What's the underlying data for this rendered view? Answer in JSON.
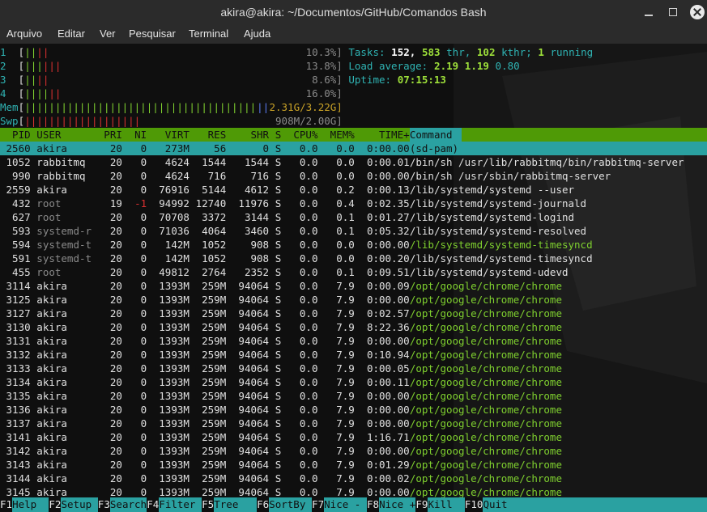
{
  "window": {
    "title": "akira@akira: ~/Documentos/GitHub/Comandos Bash"
  },
  "menu": [
    "Arquivo",
    "Editar",
    "Ver",
    "Pesquisar",
    "Terminal",
    "Ajuda"
  ],
  "meters": {
    "cpus": [
      {
        "id": "1",
        "bar_green": "||",
        "bar_red": "||",
        "pct": "10.3%]"
      },
      {
        "id": "2",
        "bar_green": "|||",
        "bar_red": "|||",
        "pct": "13.8%]"
      },
      {
        "id": "3",
        "bar_green": "||",
        "bar_red": "||",
        "pct": "8.6%]"
      },
      {
        "id": "4",
        "bar_green": "||||",
        "bar_red": "||",
        "pct": "16.0%]"
      }
    ],
    "mem": {
      "label": "Mem",
      "bar": "||||||||||||||||||||||||||||||||||||||",
      "value": "2.31G/3.22G"
    },
    "swp": {
      "label": "Swp",
      "bar": "|||||||||||||||||||",
      "value": "908M/2.00G"
    }
  },
  "summary": {
    "tasks_label": "Tasks:",
    "tasks": "152",
    "thr": "583",
    "thr_label": "thr,",
    "kthr": "102",
    "kthr_label": "kthr;",
    "running": "1",
    "running_label": "running",
    "load_label": "Load average:",
    "load1": "2.19",
    "load5": "1.19",
    "load15": "0.80",
    "uptime_label": "Uptime:",
    "uptime": "07:15:13"
  },
  "columns": [
    "PID",
    "USER",
    "PRI",
    "NI",
    "VIRT",
    "RES",
    "SHR",
    "S",
    "CPU%",
    "MEM%",
    "TIME+",
    "Command"
  ],
  "processes": [
    {
      "pid": "2560",
      "user": "akira",
      "pri": "20",
      "ni": "0",
      "virt": "273M",
      "res": "56",
      "shr": "0",
      "s": "S",
      "cpu": "0.0",
      "mem": "0.0",
      "time": "0:00.00",
      "cmd": "(sd-pam)"
    },
    {
      "pid": "1052",
      "user": "rabbitmq",
      "pri": "20",
      "ni": "0",
      "virt": "4624",
      "res": "1544",
      "shr": "1544",
      "s": "S",
      "cpu": "0.0",
      "mem": "0.0",
      "time": "0:00.01",
      "cmd": "/bin/sh /usr/lib/rabbitmq/bin/rabbitmq-server"
    },
    {
      "pid": "990",
      "user": "rabbitmq",
      "pri": "20",
      "ni": "0",
      "virt": "4624",
      "res": "716",
      "shr": "716",
      "s": "S",
      "cpu": "0.0",
      "mem": "0.0",
      "time": "0:00.00",
      "cmd": "/bin/sh /usr/sbin/rabbitmq-server"
    },
    {
      "pid": "2559",
      "user": "akira",
      "pri": "20",
      "ni": "0",
      "virt": "76916",
      "res": "5144",
      "shr": "4612",
      "s": "S",
      "cpu": "0.0",
      "mem": "0.2",
      "time": "0:00.13",
      "cmd": "/lib/systemd/systemd --user"
    },
    {
      "pid": "432",
      "user": "root",
      "pri": "19",
      "ni": "-1",
      "virt": "94992",
      "res": "12740",
      "shr": "11976",
      "s": "S",
      "cpu": "0.0",
      "mem": "0.4",
      "time": "0:02.35",
      "cmd": "/lib/systemd/systemd-journald"
    },
    {
      "pid": "627",
      "user": "root",
      "pri": "20",
      "ni": "0",
      "virt": "70708",
      "res": "3372",
      "shr": "3144",
      "s": "S",
      "cpu": "0.0",
      "mem": "0.1",
      "time": "0:01.27",
      "cmd": "/lib/systemd/systemd-logind"
    },
    {
      "pid": "593",
      "user": "systemd-r",
      "pri": "20",
      "ni": "0",
      "virt": "71036",
      "res": "4064",
      "shr": "3460",
      "s": "S",
      "cpu": "0.0",
      "mem": "0.1",
      "time": "0:05.32",
      "cmd": "/lib/systemd/systemd-resolved"
    },
    {
      "pid": "594",
      "user": "systemd-t",
      "pri": "20",
      "ni": "0",
      "virt": "142M",
      "res": "1052",
      "shr": "908",
      "s": "S",
      "cpu": "0.0",
      "mem": "0.0",
      "time": "0:00.00",
      "cmd": "/lib/systemd/systemd-timesyncd"
    },
    {
      "pid": "591",
      "user": "systemd-t",
      "pri": "20",
      "ni": "0",
      "virt": "142M",
      "res": "1052",
      "shr": "908",
      "s": "S",
      "cpu": "0.0",
      "mem": "0.0",
      "time": "0:00.20",
      "cmd": "/lib/systemd/systemd-timesyncd"
    },
    {
      "pid": "455",
      "user": "root",
      "pri": "20",
      "ni": "0",
      "virt": "49812",
      "res": "2764",
      "shr": "2352",
      "s": "S",
      "cpu": "0.0",
      "mem": "0.1",
      "time": "0:09.51",
      "cmd": "/lib/systemd/systemd-udevd"
    },
    {
      "pid": "3114",
      "user": "akira",
      "pri": "20",
      "ni": "0",
      "virt": "1393M",
      "res": "259M",
      "shr": "94064",
      "s": "S",
      "cpu": "0.0",
      "mem": "7.9",
      "time": "0:00.09",
      "cmd": "/opt/google/chrome/chrome"
    },
    {
      "pid": "3125",
      "user": "akira",
      "pri": "20",
      "ni": "0",
      "virt": "1393M",
      "res": "259M",
      "shr": "94064",
      "s": "S",
      "cpu": "0.0",
      "mem": "7.9",
      "time": "0:00.00",
      "cmd": "/opt/google/chrome/chrome"
    },
    {
      "pid": "3127",
      "user": "akira",
      "pri": "20",
      "ni": "0",
      "virt": "1393M",
      "res": "259M",
      "shr": "94064",
      "s": "S",
      "cpu": "0.0",
      "mem": "7.9",
      "time": "0:02.57",
      "cmd": "/opt/google/chrome/chrome"
    },
    {
      "pid": "3130",
      "user": "akira",
      "pri": "20",
      "ni": "0",
      "virt": "1393M",
      "res": "259M",
      "shr": "94064",
      "s": "S",
      "cpu": "0.0",
      "mem": "7.9",
      "time": "8:22.36",
      "cmd": "/opt/google/chrome/chrome"
    },
    {
      "pid": "3131",
      "user": "akira",
      "pri": "20",
      "ni": "0",
      "virt": "1393M",
      "res": "259M",
      "shr": "94064",
      "s": "S",
      "cpu": "0.0",
      "mem": "7.9",
      "time": "0:00.00",
      "cmd": "/opt/google/chrome/chrome"
    },
    {
      "pid": "3132",
      "user": "akira",
      "pri": "20",
      "ni": "0",
      "virt": "1393M",
      "res": "259M",
      "shr": "94064",
      "s": "S",
      "cpu": "0.0",
      "mem": "7.9",
      "time": "0:10.94",
      "cmd": "/opt/google/chrome/chrome"
    },
    {
      "pid": "3133",
      "user": "akira",
      "pri": "20",
      "ni": "0",
      "virt": "1393M",
      "res": "259M",
      "shr": "94064",
      "s": "S",
      "cpu": "0.0",
      "mem": "7.9",
      "time": "0:00.05",
      "cmd": "/opt/google/chrome/chrome"
    },
    {
      "pid": "3134",
      "user": "akira",
      "pri": "20",
      "ni": "0",
      "virt": "1393M",
      "res": "259M",
      "shr": "94064",
      "s": "S",
      "cpu": "0.0",
      "mem": "7.9",
      "time": "0:00.11",
      "cmd": "/opt/google/chrome/chrome"
    },
    {
      "pid": "3135",
      "user": "akira",
      "pri": "20",
      "ni": "0",
      "virt": "1393M",
      "res": "259M",
      "shr": "94064",
      "s": "S",
      "cpu": "0.0",
      "mem": "7.9",
      "time": "0:00.00",
      "cmd": "/opt/google/chrome/chrome"
    },
    {
      "pid": "3136",
      "user": "akira",
      "pri": "20",
      "ni": "0",
      "virt": "1393M",
      "res": "259M",
      "shr": "94064",
      "s": "S",
      "cpu": "0.0",
      "mem": "7.9",
      "time": "0:00.00",
      "cmd": "/opt/google/chrome/chrome"
    },
    {
      "pid": "3137",
      "user": "akira",
      "pri": "20",
      "ni": "0",
      "virt": "1393M",
      "res": "259M",
      "shr": "94064",
      "s": "S",
      "cpu": "0.0",
      "mem": "7.9",
      "time": "0:00.00",
      "cmd": "/opt/google/chrome/chrome"
    },
    {
      "pid": "3141",
      "user": "akira",
      "pri": "20",
      "ni": "0",
      "virt": "1393M",
      "res": "259M",
      "shr": "94064",
      "s": "S",
      "cpu": "0.0",
      "mem": "7.9",
      "time": "1:16.71",
      "cmd": "/opt/google/chrome/chrome"
    },
    {
      "pid": "3142",
      "user": "akira",
      "pri": "20",
      "ni": "0",
      "virt": "1393M",
      "res": "259M",
      "shr": "94064",
      "s": "S",
      "cpu": "0.0",
      "mem": "7.9",
      "time": "0:00.00",
      "cmd": "/opt/google/chrome/chrome"
    },
    {
      "pid": "3143",
      "user": "akira",
      "pri": "20",
      "ni": "0",
      "virt": "1393M",
      "res": "259M",
      "shr": "94064",
      "s": "S",
      "cpu": "0.0",
      "mem": "7.9",
      "time": "0:01.29",
      "cmd": "/opt/google/chrome/chrome"
    },
    {
      "pid": "3144",
      "user": "akira",
      "pri": "20",
      "ni": "0",
      "virt": "1393M",
      "res": "259M",
      "shr": "94064",
      "s": "S",
      "cpu": "0.0",
      "mem": "7.9",
      "time": "0:00.02",
      "cmd": "/opt/google/chrome/chrome"
    },
    {
      "pid": "3145",
      "user": "akira",
      "pri": "20",
      "ni": "0",
      "virt": "1393M",
      "res": "259M",
      "shr": "94064",
      "s": "S",
      "cpu": "0.0",
      "mem": "7.9",
      "time": "0:00.00",
      "cmd": "/opt/google/chrome/chrome"
    }
  ],
  "footer": [
    {
      "key": "F1",
      "label": "Help"
    },
    {
      "key": "F2",
      "label": "Setup"
    },
    {
      "key": "F3",
      "label": "Search"
    },
    {
      "key": "F4",
      "label": "Filter"
    },
    {
      "key": "F5",
      "label": "Tree"
    },
    {
      "key": "F6",
      "label": "SortBy"
    },
    {
      "key": "F7",
      "label": "Nice -"
    },
    {
      "key": "F8",
      "label": "Nice +"
    },
    {
      "key": "F9",
      "label": "Kill"
    },
    {
      "key": "F10",
      "label": "Quit"
    }
  ],
  "colors": {
    "header_bg": "#4f9a06",
    "selection_bg": "#2aa1a1",
    "terminal_bg": "#0f0f0f"
  }
}
